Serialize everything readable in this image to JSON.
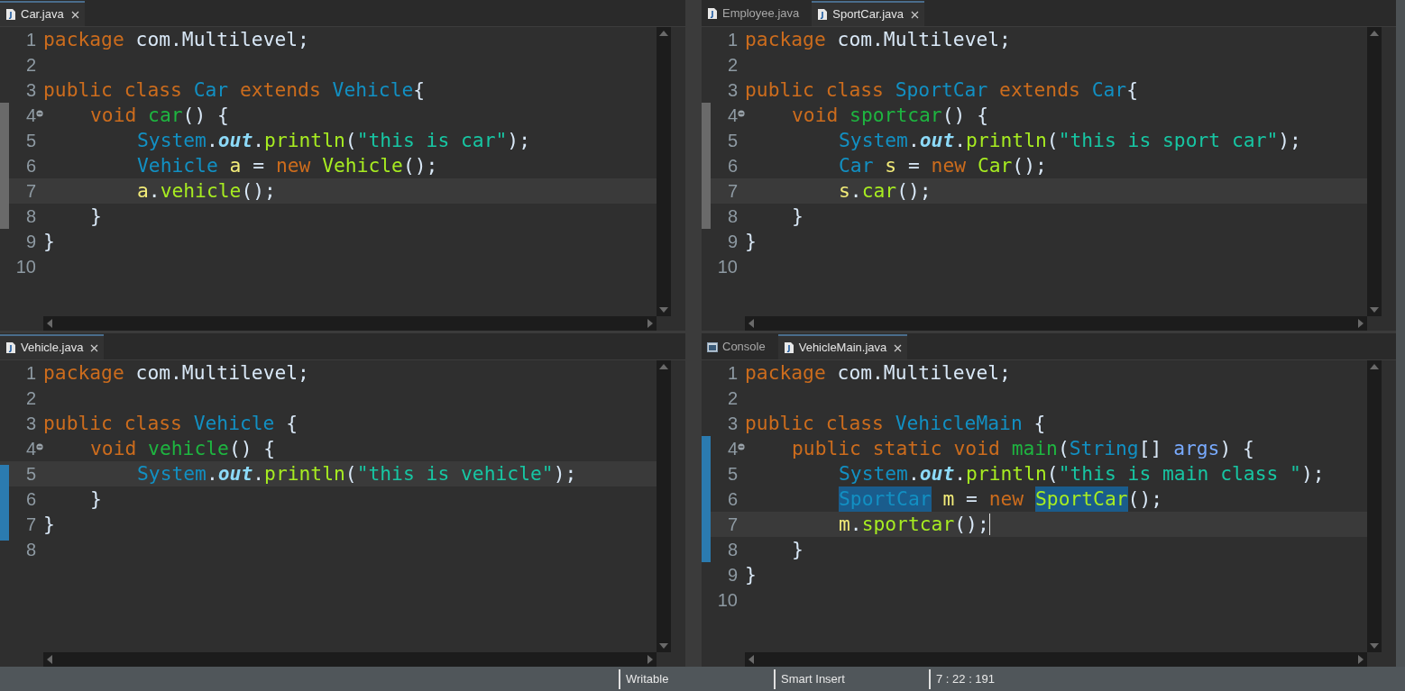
{
  "panes": [
    {
      "tabs": [
        {
          "label": "Car.java",
          "kind": "java",
          "selected": true,
          "closable": true
        }
      ],
      "lines": [
        {
          "number": "1",
          "tokens": [
            {
              "kind": "kw",
              "text": "package"
            },
            {
              "kind": "plain",
              "text": " com.Multilevel;"
            }
          ]
        },
        {
          "number": "2"
        },
        {
          "number": "3",
          "tokens": [
            {
              "kind": "kw",
              "text": "public class "
            },
            {
              "kind": "type",
              "text": "Car"
            },
            {
              "kind": "kw",
              "text": " extends "
            },
            {
              "kind": "type",
              "text": "Vehicle"
            },
            {
              "kind": "plain",
              "text": "{"
            }
          ],
          "children": [
            {
              "number": "4",
              "foldable": true,
              "tokens": [
                {
                  "kind": "kw",
                  "text": "void "
                },
                {
                  "kind": "decl",
                  "text": "car"
                },
                {
                  "kind": "plain",
                  "text": "() {"
                }
              ],
              "children": [
                {
                  "number": "5",
                  "tokens": [
                    {
                      "kind": "type",
                      "text": "System"
                    },
                    {
                      "kind": "plain",
                      "text": "."
                    },
                    {
                      "kind": "field",
                      "text": "out"
                    },
                    {
                      "kind": "plain",
                      "text": "."
                    },
                    {
                      "kind": "call",
                      "text": "println"
                    },
                    {
                      "kind": "plain",
                      "text": "("
                    },
                    {
                      "kind": "string",
                      "text": "\"this is car\""
                    },
                    {
                      "kind": "plain",
                      "text": ");"
                    }
                  ]
                },
                {
                  "number": "6",
                  "tokens": [
                    {
                      "kind": "type",
                      "text": "Vehicle "
                    },
                    {
                      "kind": "local",
                      "text": "a"
                    },
                    {
                      "kind": "plain",
                      "text": " = "
                    },
                    {
                      "kind": "kw",
                      "text": "new "
                    },
                    {
                      "kind": "call",
                      "text": "Vehicle"
                    },
                    {
                      "kind": "plain",
                      "text": "();"
                    }
                  ]
                },
                {
                  "number": "7",
                  "current": true,
                  "tokens": [
                    {
                      "kind": "local",
                      "text": "a"
                    },
                    {
                      "kind": "plain",
                      "text": "."
                    },
                    {
                      "kind": "call",
                      "text": "vehicle"
                    },
                    {
                      "kind": "plain",
                      "text": "();"
                    }
                  ]
                }
              ]
            },
            {
              "number": "8",
              "tokens": [
                {
                  "kind": "plain",
                  "text": "}"
                }
              ]
            }
          ]
        },
        {
          "number": "9",
          "tokens": [
            {
              "kind": "plain",
              "text": "}"
            }
          ]
        },
        {
          "number": "10"
        }
      ]
    },
    {
      "tabs": [
        {
          "label": "Employee.java",
          "kind": "java",
          "selected": false,
          "closable": false
        },
        {
          "label": "SportCar.java",
          "kind": "java",
          "selected": true,
          "closable": true
        }
      ],
      "lines": [
        {
          "number": "1",
          "tokens": [
            {
              "kind": "kw",
              "text": "package"
            },
            {
              "kind": "plain",
              "text": " com.Multilevel;"
            }
          ]
        },
        {
          "number": "2"
        },
        {
          "number": "3",
          "tokens": [
            {
              "kind": "kw",
              "text": "public class "
            },
            {
              "kind": "type",
              "text": "SportCar"
            },
            {
              "kind": "kw",
              "text": " extends "
            },
            {
              "kind": "type",
              "text": "Car"
            },
            {
              "kind": "plain",
              "text": "{"
            }
          ],
          "children": [
            {
              "number": "4",
              "foldable": true,
              "tokens": [
                {
                  "kind": "kw",
                  "text": "void "
                },
                {
                  "kind": "decl",
                  "text": "sportcar"
                },
                {
                  "kind": "plain",
                  "text": "() {"
                }
              ],
              "children": [
                {
                  "number": "5",
                  "tokens": [
                    {
                      "kind": "type",
                      "text": "System"
                    },
                    {
                      "kind": "plain",
                      "text": "."
                    },
                    {
                      "kind": "field",
                      "text": "out"
                    },
                    {
                      "kind": "plain",
                      "text": "."
                    },
                    {
                      "kind": "call",
                      "text": "println"
                    },
                    {
                      "kind": "plain",
                      "text": "("
                    },
                    {
                      "kind": "string",
                      "text": "\"this is sport car\""
                    },
                    {
                      "kind": "plain",
                      "text": ");"
                    }
                  ]
                },
                {
                  "number": "6",
                  "tokens": [
                    {
                      "kind": "type",
                      "text": "Car "
                    },
                    {
                      "kind": "local",
                      "text": "s"
                    },
                    {
                      "kind": "plain",
                      "text": " = "
                    },
                    {
                      "kind": "kw",
                      "text": "new "
                    },
                    {
                      "kind": "call",
                      "text": "Car"
                    },
                    {
                      "kind": "plain",
                      "text": "();"
                    }
                  ]
                },
                {
                  "number": "7",
                  "current": true,
                  "tokens": [
                    {
                      "kind": "local",
                      "text": "s"
                    },
                    {
                      "kind": "plain",
                      "text": "."
                    },
                    {
                      "kind": "call",
                      "text": "car"
                    },
                    {
                      "kind": "plain",
                      "text": "();"
                    }
                  ]
                }
              ]
            },
            {
              "number": "8",
              "tokens": [
                {
                  "kind": "plain",
                  "text": "}"
                }
              ]
            }
          ]
        },
        {
          "number": "9",
          "tokens": [
            {
              "kind": "plain",
              "text": "}"
            }
          ]
        },
        {
          "number": "10"
        }
      ]
    },
    {
      "tabs": [
        {
          "label": "Vehicle.java",
          "kind": "java",
          "selected": true,
          "closable": true
        }
      ],
      "lines": [
        {
          "number": "1",
          "tokens": [
            {
              "kind": "kw",
              "text": "package"
            },
            {
              "kind": "plain",
              "text": " com.Multilevel;"
            }
          ]
        },
        {
          "number": "2"
        },
        {
          "number": "3",
          "tokens": [
            {
              "kind": "kw",
              "text": "public class "
            },
            {
              "kind": "type",
              "text": "Vehicle"
            },
            {
              "kind": "plain",
              "text": " {"
            }
          ],
          "children": [
            {
              "number": "4",
              "foldable": true,
              "tokens": [
                {
                  "kind": "kw",
                  "text": "void "
                },
                {
                  "kind": "decl",
                  "text": "vehicle"
                },
                {
                  "kind": "plain",
                  "text": "() {"
                }
              ],
              "children": [
                {
                  "number": "5",
                  "current": true,
                  "tokens": [
                    {
                      "kind": "type",
                      "text": "System"
                    },
                    {
                      "kind": "plain",
                      "text": "."
                    },
                    {
                      "kind": "field",
                      "text": "out"
                    },
                    {
                      "kind": "plain",
                      "text": "."
                    },
                    {
                      "kind": "call",
                      "text": "println"
                    },
                    {
                      "kind": "plain",
                      "text": "("
                    },
                    {
                      "kind": "string",
                      "text": "\"this is vehicle\""
                    },
                    {
                      "kind": "plain",
                      "text": ");"
                    }
                  ]
                }
              ]
            },
            {
              "number": "6",
              "tokens": [
                {
                  "kind": "plain",
                  "text": "}"
                }
              ]
            }
          ]
        },
        {
          "number": "7",
          "tokens": [
            {
              "kind": "plain",
              "text": "}"
            }
          ]
        },
        {
          "number": "8"
        }
      ]
    },
    {
      "tabs": [
        {
          "label": "Console",
          "kind": "console",
          "selected": false,
          "closable": false
        },
        {
          "label": "VehicleMain.java",
          "kind": "java",
          "selected": true,
          "closable": true
        }
      ],
      "lines": [
        {
          "number": "1",
          "tokens": [
            {
              "kind": "kw",
              "text": "package"
            },
            {
              "kind": "plain",
              "text": " com.Multilevel;"
            }
          ]
        },
        {
          "number": "2"
        },
        {
          "number": "3",
          "tokens": [
            {
              "kind": "kw",
              "text": "public class "
            },
            {
              "kind": "type",
              "text": "VehicleMain"
            },
            {
              "kind": "plain",
              "text": " {"
            }
          ],
          "children": [
            {
              "number": "4",
              "foldable": true,
              "tokens": [
                {
                  "kind": "kw",
                  "text": "public static void "
                },
                {
                  "kind": "decl",
                  "text": "main"
                },
                {
                  "kind": "plain",
                  "text": "("
                },
                {
                  "kind": "type",
                  "text": "String"
                },
                {
                  "kind": "plain",
                  "text": "[] "
                },
                {
                  "kind": "param",
                  "text": "args"
                },
                {
                  "kind": "plain",
                  "text": ") {"
                }
              ],
              "children": [
                {
                  "number": "5",
                  "tokens": [
                    {
                      "kind": "type",
                      "text": "System"
                    },
                    {
                      "kind": "plain",
                      "text": "."
                    },
                    {
                      "kind": "field",
                      "text": "out"
                    },
                    {
                      "kind": "plain",
                      "text": "."
                    },
                    {
                      "kind": "call",
                      "text": "println"
                    },
                    {
                      "kind": "plain",
                      "text": "("
                    },
                    {
                      "kind": "string",
                      "text": "\"this is main class \""
                    },
                    {
                      "kind": "plain",
                      "text": ");"
                    }
                  ]
                },
                {
                  "number": "6",
                  "tokens": [
                    {
                      "kind": "type",
                      "text": "SportCar",
                      "occurrence": true
                    },
                    {
                      "kind": "local",
                      "text": " m"
                    },
                    {
                      "kind": "plain",
                      "text": " = "
                    },
                    {
                      "kind": "kw",
                      "text": "new "
                    },
                    {
                      "kind": "call",
                      "text": "SportCar",
                      "occurrence": true
                    },
                    {
                      "kind": "plain",
                      "text": "();"
                    }
                  ]
                },
                {
                  "number": "7",
                  "current": true,
                  "caret": true,
                  "tokens": [
                    {
                      "kind": "local",
                      "text": "m"
                    },
                    {
                      "kind": "plain",
                      "text": "."
                    },
                    {
                      "kind": "call",
                      "text": "sportcar"
                    },
                    {
                      "kind": "plain",
                      "text": "();"
                    }
                  ]
                }
              ]
            },
            {
              "number": "8",
              "tokens": [
                {
                  "kind": "plain",
                  "text": "}"
                }
              ]
            }
          ]
        },
        {
          "number": "9",
          "tokens": [
            {
              "kind": "plain",
              "text": "}"
            }
          ]
        },
        {
          "number": "10"
        }
      ]
    }
  ],
  "status_bar": [
    {
      "text": "Writable"
    },
    {
      "text": "Smart Insert"
    },
    {
      "text": "7 : 22 : 191"
    }
  ]
}
